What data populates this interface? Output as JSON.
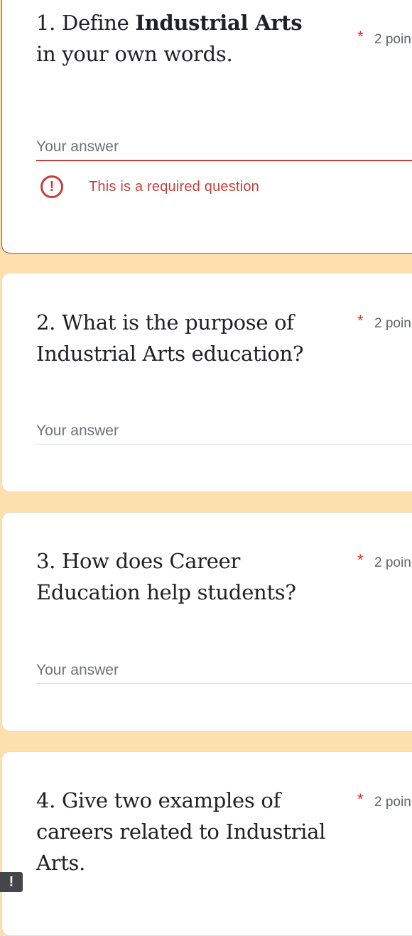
{
  "questions": [
    {
      "text_pre": "1. Define ",
      "text_bold": "Industrial Arts",
      "text_post": " in your own words.",
      "required_mark": "*",
      "points": "2 poin",
      "answer_placeholder": "Your answer",
      "error_text": "This is a required question",
      "error_icon_glyph": "!"
    },
    {
      "text": "2. What is the purpose of Industrial Arts education?",
      "required_mark": "*",
      "points": "2 poin",
      "answer_placeholder": "Your answer"
    },
    {
      "text": "3.  How does Career Education help students?",
      "required_mark": "*",
      "points": "2 poin",
      "answer_placeholder": "Your answer"
    },
    {
      "text": "4.  Give two examples of careers related to Industrial Arts.",
      "required_mark": "*",
      "points": "2 poin"
    }
  ],
  "side_flag_glyph": "!",
  "colors": {
    "background": "#fde0ae",
    "error": "#c5403a",
    "required": "#d93025",
    "text": "#202124",
    "muted": "#5f6368"
  }
}
